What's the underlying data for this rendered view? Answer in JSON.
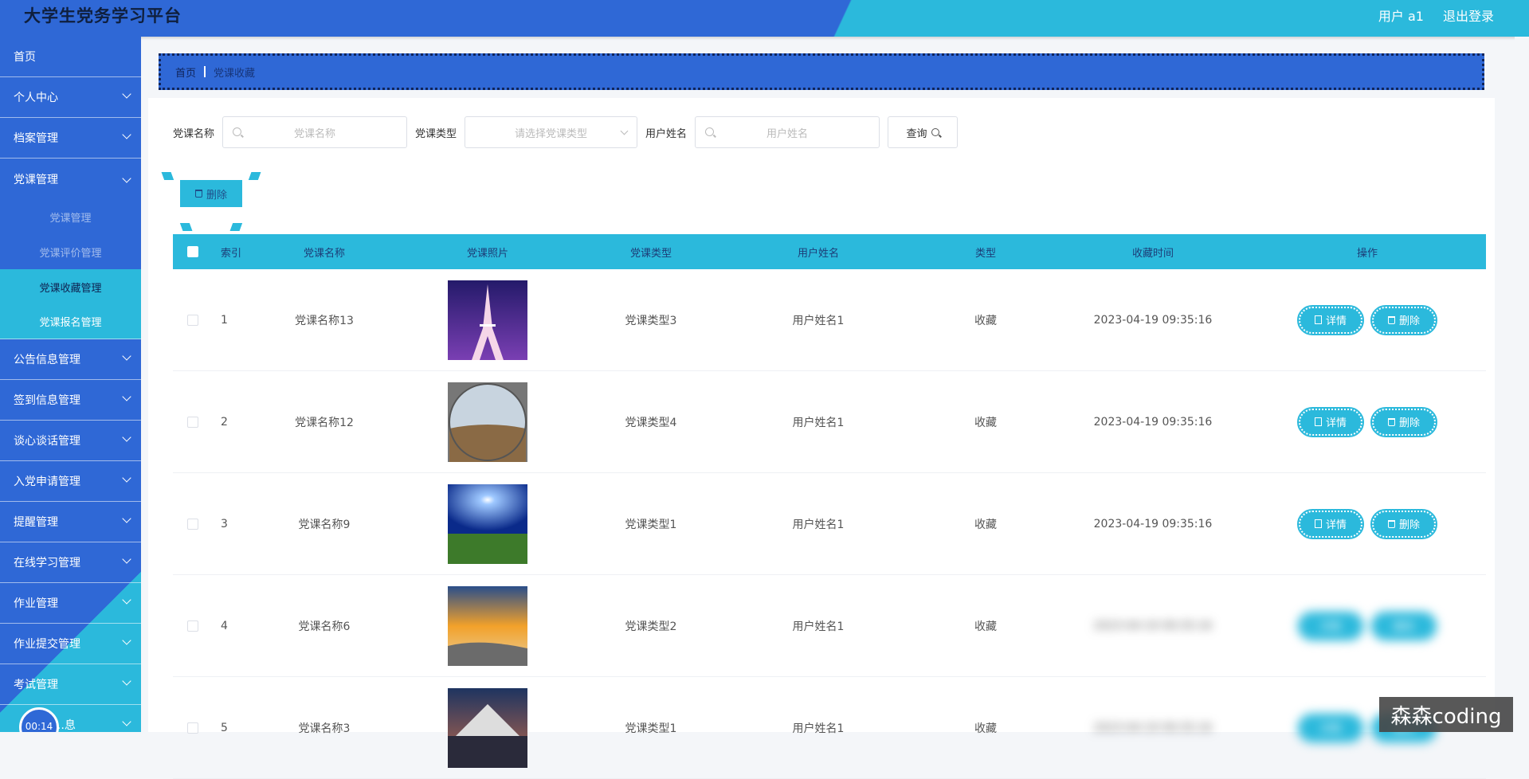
{
  "app": {
    "title": "大学生党务学习平台",
    "user_label": "用户 a1",
    "logout_label": "退出登录"
  },
  "sidebar": {
    "items": [
      {
        "label": "首页"
      },
      {
        "label": "个人中心"
      },
      {
        "label": "档案管理"
      },
      {
        "label": "党课管理"
      },
      {
        "label": "公告信息管理"
      },
      {
        "label": "签到信息管理"
      },
      {
        "label": "谈心谈话管理"
      },
      {
        "label": "入党申请管理"
      },
      {
        "label": "提醒管理"
      },
      {
        "label": "在线学习管理"
      },
      {
        "label": "作业管理"
      },
      {
        "label": "作业提交管理"
      },
      {
        "label": "考试管理"
      },
      {
        "label": "…息"
      }
    ],
    "submenu": [
      {
        "label": "党课管理"
      },
      {
        "label": "党课评价管理"
      },
      {
        "label": "党课收藏管理"
      },
      {
        "label": "党课报名管理"
      }
    ],
    "timer": "00:14"
  },
  "breadcrumb": {
    "home": "首页",
    "current": "党课收藏"
  },
  "filters": {
    "name_label": "党课名称",
    "name_placeholder": "党课名称",
    "type_label": "党课类型",
    "type_placeholder": "请选择党课类型",
    "user_label": "用户姓名",
    "user_placeholder": "用户姓名",
    "search_button": "查询"
  },
  "bulk_delete_label": "删除",
  "table": {
    "headers": {
      "index": "索引",
      "name": "党课名称",
      "photo": "党课照片",
      "type": "党课类型",
      "user": "用户姓名",
      "kind": "类型",
      "time": "收藏时间",
      "ops": "操作"
    },
    "detail_label": "详情",
    "delete_label": "删除",
    "rows": [
      {
        "index": "1",
        "name": "党课名称13",
        "type": "党课类型3",
        "user": "用户姓名1",
        "kind": "收藏",
        "time": "2023-04-19 09:35:16"
      },
      {
        "index": "2",
        "name": "党课名称12",
        "type": "党课类型4",
        "user": "用户姓名1",
        "kind": "收藏",
        "time": "2023-04-19 09:35:16"
      },
      {
        "index": "3",
        "name": "党课名称9",
        "type": "党课类型1",
        "user": "用户姓名1",
        "kind": "收藏",
        "time": "2023-04-19 09:35:16"
      },
      {
        "index": "4",
        "name": "党课名称6",
        "type": "党课类型2",
        "user": "用户姓名1",
        "kind": "收藏",
        "time": "2023-04-19 09:35:16"
      },
      {
        "index": "5",
        "name": "党课名称3",
        "type": "党课类型1",
        "user": "用户姓名1",
        "kind": "收藏",
        "time": "2023-04-19 09:35:16"
      }
    ]
  },
  "watermark": "森森coding",
  "colors": {
    "primary": "#2f68d6",
    "accent": "#2bb9dc",
    "dark": "#10245a"
  }
}
